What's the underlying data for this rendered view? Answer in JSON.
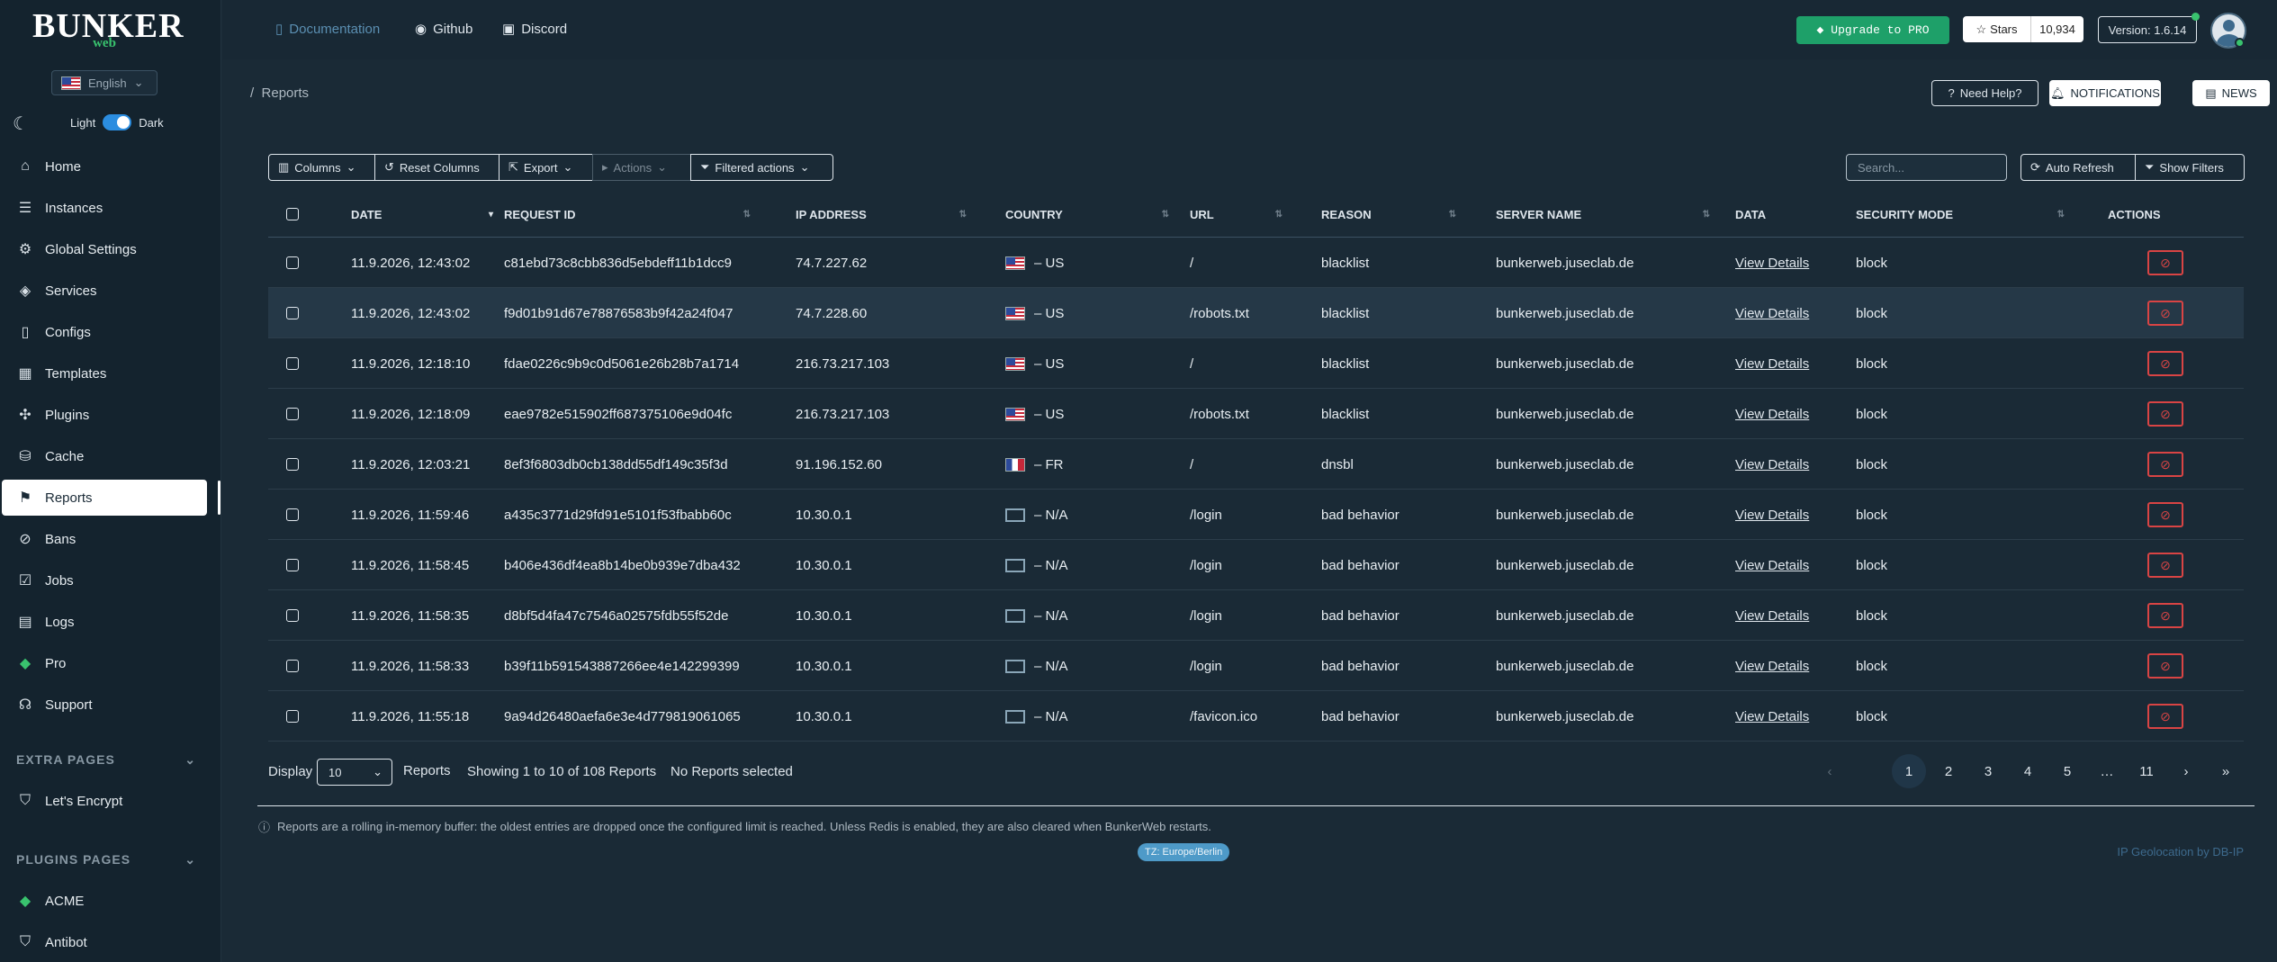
{
  "brand": {
    "title": "BUNKER",
    "sub": "web"
  },
  "lang": {
    "label": "English"
  },
  "theme": {
    "light": "Light",
    "dark": "Dark"
  },
  "nav": [
    {
      "label": "Home"
    },
    {
      "label": "Instances"
    },
    {
      "label": "Global Settings"
    },
    {
      "label": "Services"
    },
    {
      "label": "Configs"
    },
    {
      "label": "Templates"
    },
    {
      "label": "Plugins"
    },
    {
      "label": "Cache"
    },
    {
      "label": "Reports"
    },
    {
      "label": "Bans"
    },
    {
      "label": "Jobs"
    },
    {
      "label": "Logs"
    },
    {
      "label": "Pro"
    },
    {
      "label": "Support"
    }
  ],
  "extra": {
    "title": "EXTRA PAGES",
    "items": [
      {
        "label": "Let's Encrypt"
      }
    ]
  },
  "plugins_pages": {
    "title": "PLUGINS PAGES",
    "items": [
      {
        "label": "ACME"
      },
      {
        "label": "Antibot"
      }
    ]
  },
  "top": {
    "documentation": "Documentation",
    "github": "Github",
    "discord": "Discord",
    "upgrade": "Upgrade to PRO",
    "stars": "Stars",
    "stars_count": "10,934",
    "version": "Version: 1.6.14"
  },
  "breadcrumb": {
    "sep": "/",
    "current": "Reports"
  },
  "header_buttons": {
    "help": "Need Help?",
    "notifications": "NOTIFICATIONS",
    "news": "NEWS"
  },
  "toolbar": {
    "columns": "Columns",
    "reset": "Reset Columns",
    "export": "Export",
    "actions": "Actions",
    "filtered": "Filtered actions",
    "search_placeholder": "Search...",
    "auto_refresh": "Auto Refresh",
    "show_filters": "Show Filters"
  },
  "table": {
    "headers": {
      "date": "DATE",
      "request_id": "REQUEST ID",
      "ip": "IP ADDRESS",
      "country": "COUNTRY",
      "url": "URL",
      "reason": "REASON",
      "server": "SERVER NAME",
      "data": "DATA",
      "mode": "SECURITY MODE",
      "actions": "ACTIONS"
    },
    "rows": [
      {
        "date": "11.9.2026, 12:43:02",
        "request_id": "c81ebd73c8cbb836d5ebdeff11b1dcc9",
        "ip": "74.7.227.62",
        "flag": "us",
        "country": "– US",
        "url": "/",
        "reason": "blacklist",
        "server": "bunkerweb.juseclab.de",
        "data": "View Details",
        "mode": "block"
      },
      {
        "date": "11.9.2026, 12:43:02",
        "request_id": "f9d01b91d67e78876583b9f42a24f047",
        "ip": "74.7.228.60",
        "flag": "us",
        "country": "– US",
        "url": "/robots.txt",
        "reason": "blacklist",
        "server": "bunkerweb.juseclab.de",
        "data": "View Details",
        "mode": "block"
      },
      {
        "date": "11.9.2026, 12:18:10",
        "request_id": "fdae0226c9b9c0d5061e26b28b7a1714",
        "ip": "216.73.217.103",
        "flag": "us",
        "country": "– US",
        "url": "/",
        "reason": "blacklist",
        "server": "bunkerweb.juseclab.de",
        "data": "View Details",
        "mode": "block"
      },
      {
        "date": "11.9.2026, 12:18:09",
        "request_id": "eae9782e515902ff687375106e9d04fc",
        "ip": "216.73.217.103",
        "flag": "us",
        "country": "– US",
        "url": "/robots.txt",
        "reason": "blacklist",
        "server": "bunkerweb.juseclab.de",
        "data": "View Details",
        "mode": "block"
      },
      {
        "date": "11.9.2026, 12:03:21",
        "request_id": "8ef3f6803db0cb138dd55df149c35f3d",
        "ip": "91.196.152.60",
        "flag": "fr",
        "country": "– FR",
        "url": "/",
        "reason": "dnsbl",
        "server": "bunkerweb.juseclab.de",
        "data": "View Details",
        "mode": "block"
      },
      {
        "date": "11.9.2026, 11:59:46",
        "request_id": "a435c3771d29fd91e5101f53fbabb60c",
        "ip": "10.30.0.1",
        "flag": "na",
        "country": "– N/A",
        "url": "/login",
        "reason": "bad behavior",
        "server": "bunkerweb.juseclab.de",
        "data": "View Details",
        "mode": "block"
      },
      {
        "date": "11.9.2026, 11:58:45",
        "request_id": "b406e436df4ea8b14be0b939e7dba432",
        "ip": "10.30.0.1",
        "flag": "na",
        "country": "– N/A",
        "url": "/login",
        "reason": "bad behavior",
        "server": "bunkerweb.juseclab.de",
        "data": "View Details",
        "mode": "block"
      },
      {
        "date": "11.9.2026, 11:58:35",
        "request_id": "d8bf5d4fa47c7546a02575fdb55f52de",
        "ip": "10.30.0.1",
        "flag": "na",
        "country": "– N/A",
        "url": "/login",
        "reason": "bad behavior",
        "server": "bunkerweb.juseclab.de",
        "data": "View Details",
        "mode": "block"
      },
      {
        "date": "11.9.2026, 11:58:33",
        "request_id": "b39f11b591543887266ee4e142299399",
        "ip": "10.30.0.1",
        "flag": "na",
        "country": "– N/A",
        "url": "/login",
        "reason": "bad behavior",
        "server": "bunkerweb.juseclab.de",
        "data": "View Details",
        "mode": "block"
      },
      {
        "date": "11.9.2026, 11:55:18",
        "request_id": "9a94d26480aefa6e3e4d779819061065",
        "ip": "10.30.0.1",
        "flag": "na",
        "country": "– N/A",
        "url": "/favicon.ico",
        "reason": "bad behavior",
        "server": "bunkerweb.juseclab.de",
        "data": "View Details",
        "mode": "block"
      }
    ]
  },
  "footer": {
    "display": "Display",
    "page_size": "10",
    "reports": "Reports",
    "showing": "Showing 1 to 10 of 108 Reports",
    "selected": "No Reports selected",
    "pages": [
      "1",
      "2",
      "3",
      "4",
      "5",
      "…",
      "11"
    ],
    "next": "›",
    "last": "»"
  },
  "note": "Reports are a rolling in-memory buffer: the oldest entries are dropped once the configured limit is reached. Unless Redis is enabled, they are also cleared when BunkerWeb restarts.",
  "tz": "TZ: Europe/Berlin",
  "geo": "IP Geolocation by DB-IP",
  "colors": {
    "bg": "#1a2a36",
    "sidebar": "#14232e",
    "pro": "#1ea069",
    "danger": "#d94444"
  }
}
